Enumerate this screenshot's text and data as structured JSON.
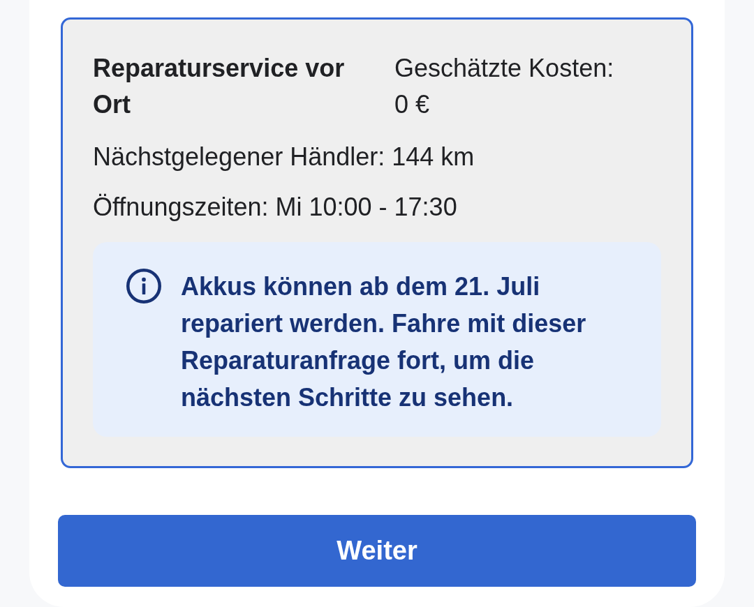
{
  "option": {
    "selected": true,
    "title": "Reparaturservice vor Ort",
    "cost_label": "Geschätzte Kosten:",
    "cost_value": "0 €",
    "details": [
      "Nächstgelegener Händler: 144 km",
      "Öffnungszeiten: Mi 10:00 - 17:30"
    ],
    "notice": {
      "text": "Akkus können ab dem 21. Juli repariert werden. Fahre mit dieser Reparaturanfrage fort, um die nächsten Schritte zu sehen."
    }
  },
  "primary_button": {
    "label": "Weiter"
  }
}
